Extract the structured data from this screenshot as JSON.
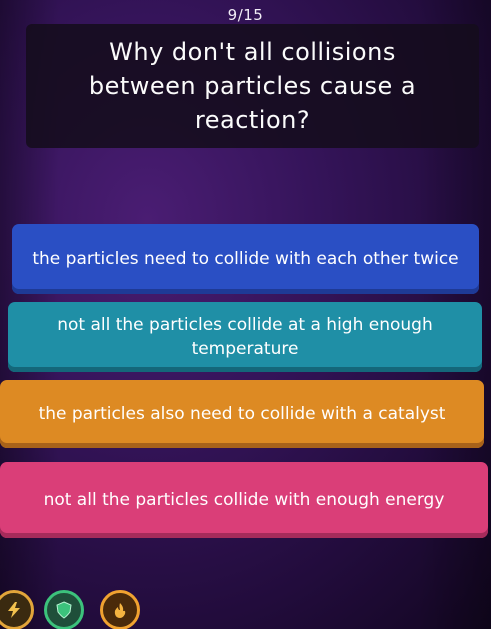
{
  "quiz": {
    "counter": "9/15",
    "question": "Why don't all collisions between particles cause a reaction?",
    "answers": [
      {
        "text": "the particles need to collide with each other twice",
        "color": "#2a4fc4"
      },
      {
        "text": "not all the particles collide at a high enough temperature",
        "color": "#1f8fa6"
      },
      {
        "text": "the particles also need to collide with a catalyst",
        "color": "#dd8a23"
      },
      {
        "text": "not all the particles collide with enough energy",
        "color": "#da3e78"
      }
    ]
  },
  "powerups": [
    {
      "icon": "power-up-icon",
      "color": "#e2a53a"
    },
    {
      "icon": "shield-icon",
      "color": "#3cc27c"
    },
    {
      "icon": "streak-icon",
      "color": "#f0a230"
    }
  ]
}
